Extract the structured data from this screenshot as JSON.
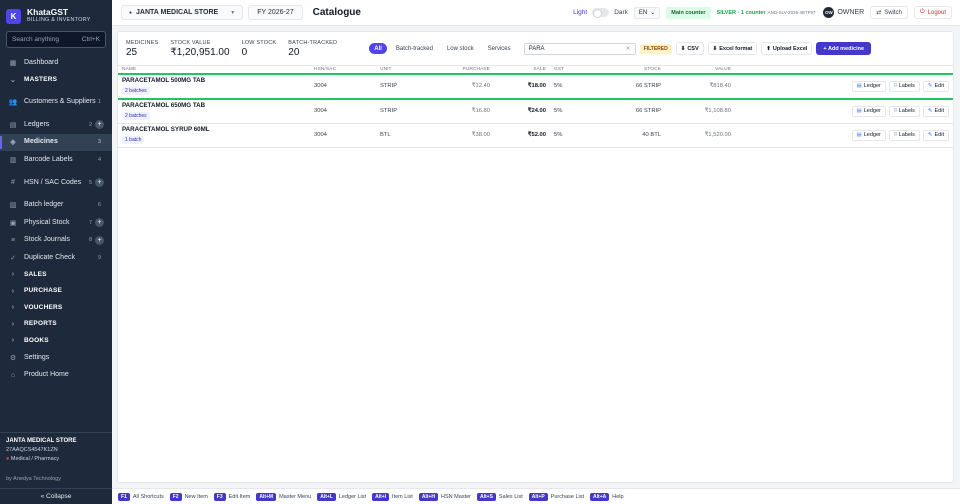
{
  "brand": {
    "logo_letter": "K",
    "title": "KhataGST",
    "subtitle": "BILLING & INVENTORY"
  },
  "search": {
    "placeholder": "Search anything",
    "shortcut": "Ctrl+K"
  },
  "sidebar": {
    "items": [
      {
        "label": "Dashboard",
        "icon": "grid-icon"
      },
      {
        "label": "MASTERS",
        "section": true,
        "expanded": true
      },
      {
        "label": "Customers & Suppliers",
        "icon": "users-icon",
        "count": "1"
      },
      {
        "label": "Ledgers",
        "icon": "ledger-icon",
        "count": "2",
        "plus": "+"
      },
      {
        "label": "Medicines",
        "icon": "pill-icon",
        "count": "3",
        "active": true
      },
      {
        "label": "Barcode Labels",
        "icon": "barcode-icon",
        "count": "4"
      },
      {
        "label": "HSN / SAC Codes",
        "icon": "hash-icon",
        "count": "5",
        "plus": "+"
      },
      {
        "label": "Batch ledger",
        "icon": "batch-icon",
        "count": "6"
      },
      {
        "label": "Physical Stock",
        "icon": "stock-icon",
        "count": "7",
        "plus": "+"
      },
      {
        "label": "Stock Journals",
        "icon": "journal-icon",
        "count": "8",
        "plus": "+"
      },
      {
        "label": "Duplicate Check",
        "icon": "check-icon",
        "count": "9"
      },
      {
        "label": "SALES",
        "section": true
      },
      {
        "label": "PURCHASE",
        "section": true
      },
      {
        "label": "VOUCHERS",
        "section": true
      },
      {
        "label": "REPORTS",
        "section": true
      },
      {
        "label": "BOOKS",
        "section": true
      },
      {
        "label": "Settings",
        "icon": "gear-icon"
      },
      {
        "label": "Product Home",
        "icon": "home-icon"
      }
    ],
    "store_name": "JANTA MEDICAL STORE",
    "store_gst": "27AAQCS4547K1ZN",
    "store_type": "Medical / Pharmacy",
    "powered_by": "by Anedya Technology",
    "collapse_label": "« Collapse"
  },
  "topbar": {
    "store": "JANTA MEDICAL STORE",
    "fy": "FY 2026-27",
    "page_title": "Catalogue",
    "theme_light": "Light",
    "theme_dark": "Dark",
    "lang": "EN",
    "counter": "Main counter",
    "license": "SILVER · 1 counter",
    "license_code": "AND-SLV-2026-4E7F97",
    "avatar": "OW",
    "role": "OWNER",
    "switch": "Switch",
    "logout": "Logout"
  },
  "stats": [
    {
      "label": "MEDICINES",
      "value": "25"
    },
    {
      "label": "STOCK VALUE",
      "value": "₹1,20,951.00"
    },
    {
      "label": "LOW STOCK",
      "value": "0"
    },
    {
      "label": "BATCH-TRACKED",
      "value": "20"
    }
  ],
  "filters": {
    "chips": [
      "All",
      "Batch-tracked",
      "Low stock",
      "Services"
    ],
    "search_value": "PARA",
    "filtered_badge": "FILTERED",
    "csv": "CSV",
    "excel_format": "Excel format",
    "upload_excel": "Upload Excel",
    "add_medicine": "+ Add medicine"
  },
  "table": {
    "headers": [
      "NAME",
      "HSN/SAC",
      "UNIT",
      "PURCHASE",
      "SALE",
      "GST",
      "STOCK",
      "VALUE"
    ],
    "rows": [
      {
        "name": "PARACETAMOL 500MG TAB",
        "batches": "2 batches",
        "hsn": "3004",
        "unit": "STRIP",
        "purchase": "₹12.40",
        "sale": "₹18.00",
        "gst": "5%",
        "stock": "66 STRIP",
        "value": "₹818.40",
        "highlight": true
      },
      {
        "name": "PARACETAMOL 650MG TAB",
        "batches": "2 batches",
        "hsn": "3004",
        "unit": "STRIP",
        "purchase": "₹16.80",
        "sale": "₹24.00",
        "gst": "5%",
        "stock": "66 STRIP",
        "value": "₹1,108.80"
      },
      {
        "name": "PARACETAMOL SYRUP 60ML",
        "batches": "1 batch",
        "hsn": "3004",
        "unit": "BTL",
        "purchase": "₹38.00",
        "sale": "₹52.00",
        "gst": "5%",
        "stock": "40 BTL",
        "value": "₹1,520.00"
      }
    ],
    "row_actions": {
      "ledger": "Ledger",
      "labels": "Labels",
      "edit": "Edit"
    }
  },
  "shortcuts": [
    {
      "key": "F1",
      "label": "All Shortcuts"
    },
    {
      "key": "F2",
      "label": "New Item"
    },
    {
      "key": "F3",
      "label": "Edit Item"
    },
    {
      "key": "Alt+M",
      "label": "Master Menu"
    },
    {
      "key": "Alt+L",
      "label": "Ledger List"
    },
    {
      "key": "Alt+I",
      "label": "Item List"
    },
    {
      "key": "Alt+H",
      "label": "HSN Master"
    },
    {
      "key": "Alt+S",
      "label": "Sales List"
    },
    {
      "key": "Alt+P",
      "label": "Purchase List"
    },
    {
      "key": "Alt+A",
      "label": "Help"
    }
  ]
}
